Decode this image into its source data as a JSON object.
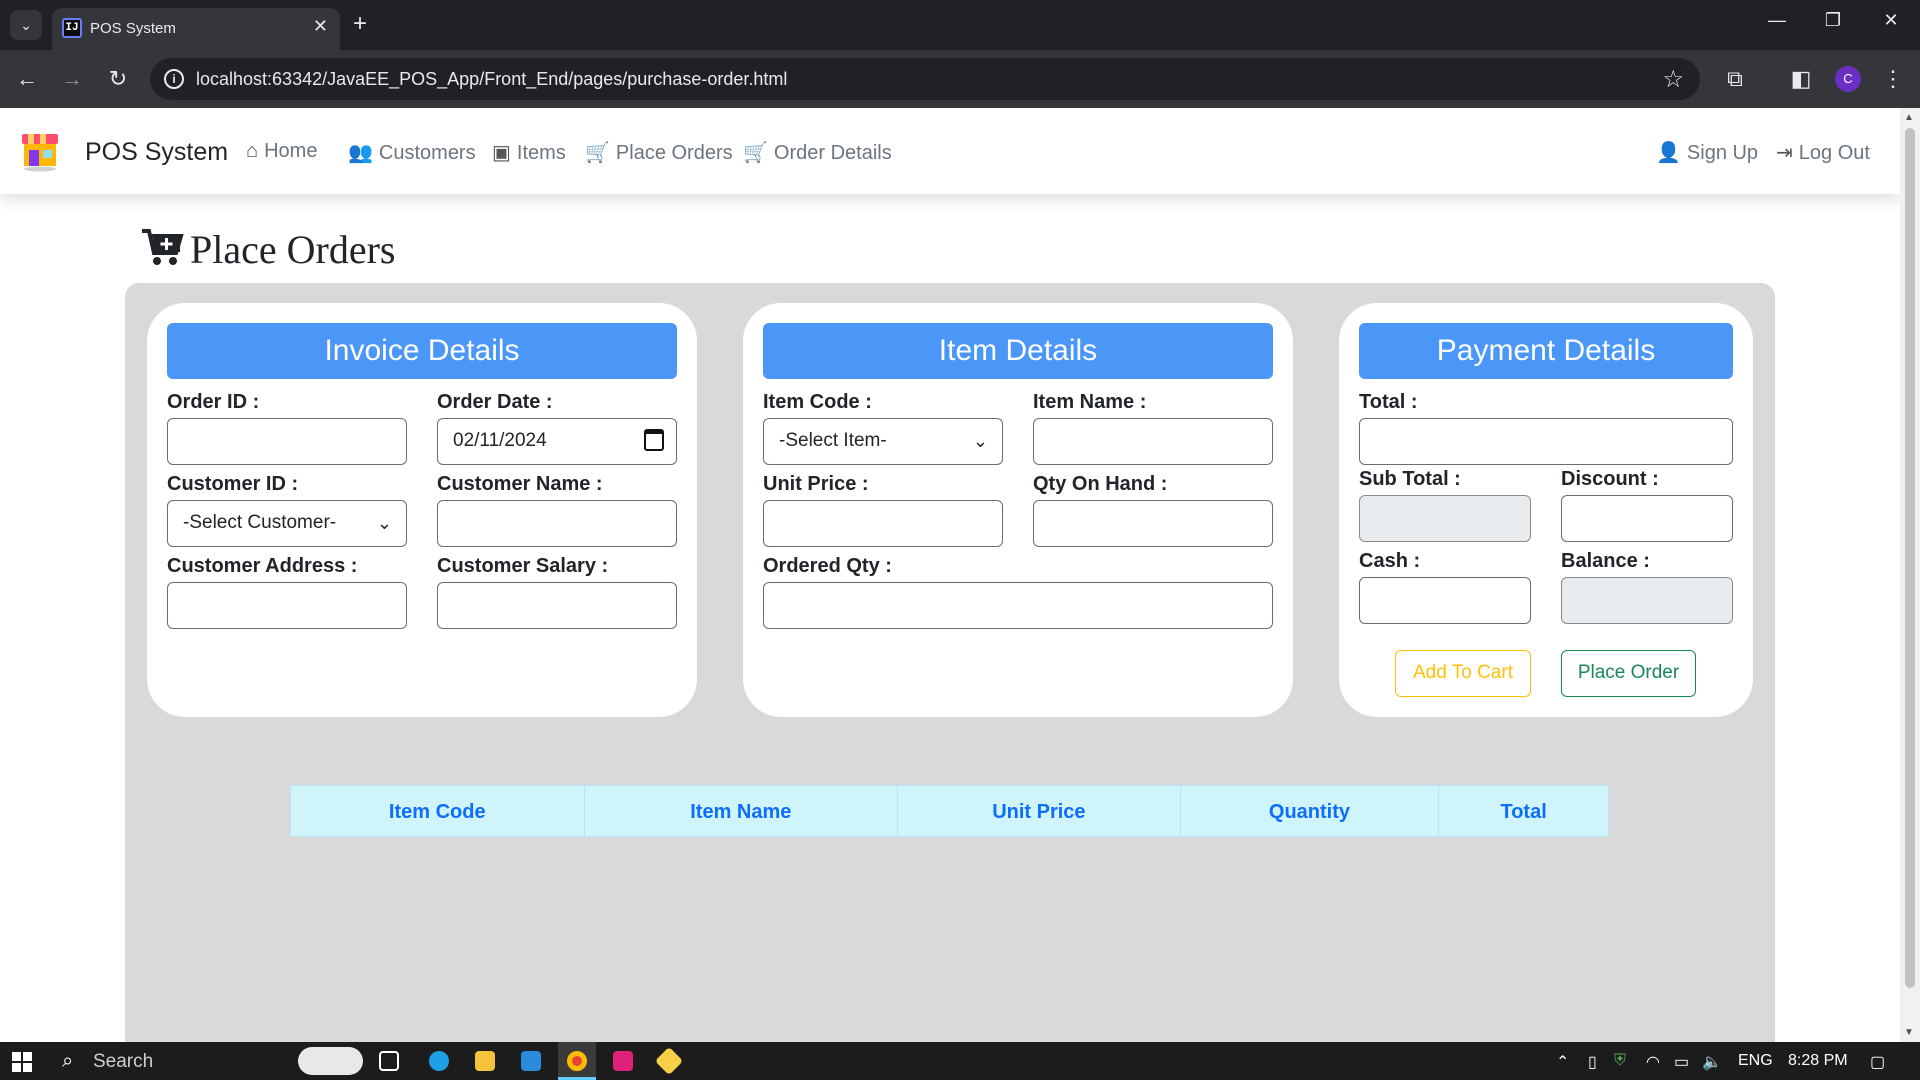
{
  "browser": {
    "tab_title": "POS System",
    "tab_favicon_text": "IJ",
    "url": "localhost:63342/JavaEE_POS_App/Front_End/pages/purchase-order.html",
    "profile_initial": "C"
  },
  "navbar": {
    "brand": "POS System",
    "items": [
      {
        "label": "Home",
        "icon": "home-icon"
      },
      {
        "label": "Customers",
        "icon": "users-icon"
      },
      {
        "label": "Items",
        "icon": "bag-icon"
      },
      {
        "label": "Place Orders",
        "icon": "cart-icon"
      },
      {
        "label": "Order Details",
        "icon": "cart-icon"
      }
    ],
    "right": [
      {
        "label": "Sign Up",
        "icon": "user-plus-icon"
      },
      {
        "label": "Log Out",
        "icon": "logout-icon"
      }
    ]
  },
  "page": {
    "title": "Place Orders"
  },
  "invoice": {
    "heading": "Invoice Details",
    "order_id_label": "Order ID :",
    "order_id_value": "",
    "order_date_label": "Order Date :",
    "order_date_value": "02/11/2024",
    "customer_id_label": "Customer ID :",
    "customer_id_selected": "-Select Customer-",
    "customer_name_label": "Customer Name :",
    "customer_address_label": "Customer Address :",
    "customer_salary_label": "Customer Salary :"
  },
  "item": {
    "heading": "Item Details",
    "item_code_label": "Item Code :",
    "item_code_selected": "-Select Item-",
    "item_name_label": "Item Name :",
    "unit_price_label": "Unit Price :",
    "qty_on_hand_label": "Qty On Hand :",
    "ordered_qty_label": "Ordered Qty :"
  },
  "payment": {
    "heading": "Payment Details",
    "total_label": "Total :",
    "sub_total_label": "Sub Total :",
    "discount_label": "Discount :",
    "cash_label": "Cash :",
    "balance_label": "Balance :",
    "add_to_cart": "Add To Cart",
    "place_order": "Place Order"
  },
  "cart_table": {
    "columns": [
      "Item Code",
      "Item Name",
      "Unit Price",
      "Quantity",
      "Total"
    ],
    "rows": []
  },
  "taskbar": {
    "search_label": "Search",
    "language": "ENG",
    "time": "8:28 PM"
  },
  "colors": {
    "card_header": "#4b97f7",
    "panel_bg": "#d9d9d9",
    "table_header_bg": "#cff4fc",
    "table_header_text": "#0d6efd",
    "warning": "#ffc107",
    "success": "#198754"
  }
}
